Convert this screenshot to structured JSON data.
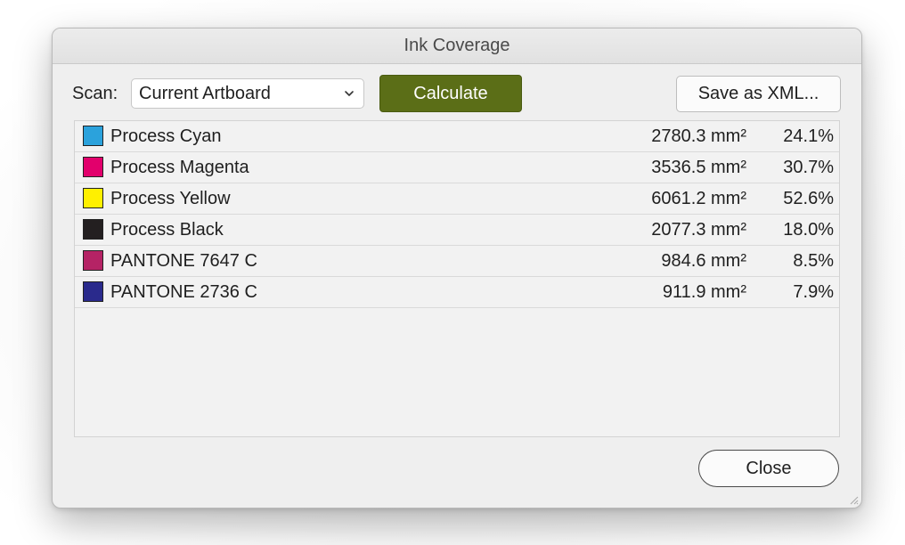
{
  "window": {
    "title": "Ink Coverage"
  },
  "toolbar": {
    "scan_label": "Scan:",
    "scan_value": "Current Artboard",
    "calculate_label": "Calculate",
    "save_xml_label": "Save as XML..."
  },
  "inks": [
    {
      "name": "Process Cyan",
      "area": "2780.3 mm²",
      "percent": "24.1%",
      "color": "#2ba2dc"
    },
    {
      "name": "Process Magenta",
      "area": "3536.5 mm²",
      "percent": "30.7%",
      "color": "#e2006c"
    },
    {
      "name": "Process Yellow",
      "area": "6061.2 mm²",
      "percent": "52.6%",
      "color": "#fff000"
    },
    {
      "name": "Process Black",
      "area": "2077.3 mm²",
      "percent": "18.0%",
      "color": "#231f20"
    },
    {
      "name": "PANTONE 7647 C",
      "area": "984.6 mm²",
      "percent": "8.5%",
      "color": "#b52365"
    },
    {
      "name": "PANTONE 2736 C",
      "area": "911.9 mm²",
      "percent": "7.9%",
      "color": "#2a2a8c"
    }
  ],
  "footer": {
    "close_label": "Close"
  },
  "icons": {
    "dropdown": "chevron-down-icon",
    "resize": "resize-grip-icon"
  },
  "colors": {
    "calculate_button": "#5b6e17",
    "window_bg": "#efefef"
  }
}
